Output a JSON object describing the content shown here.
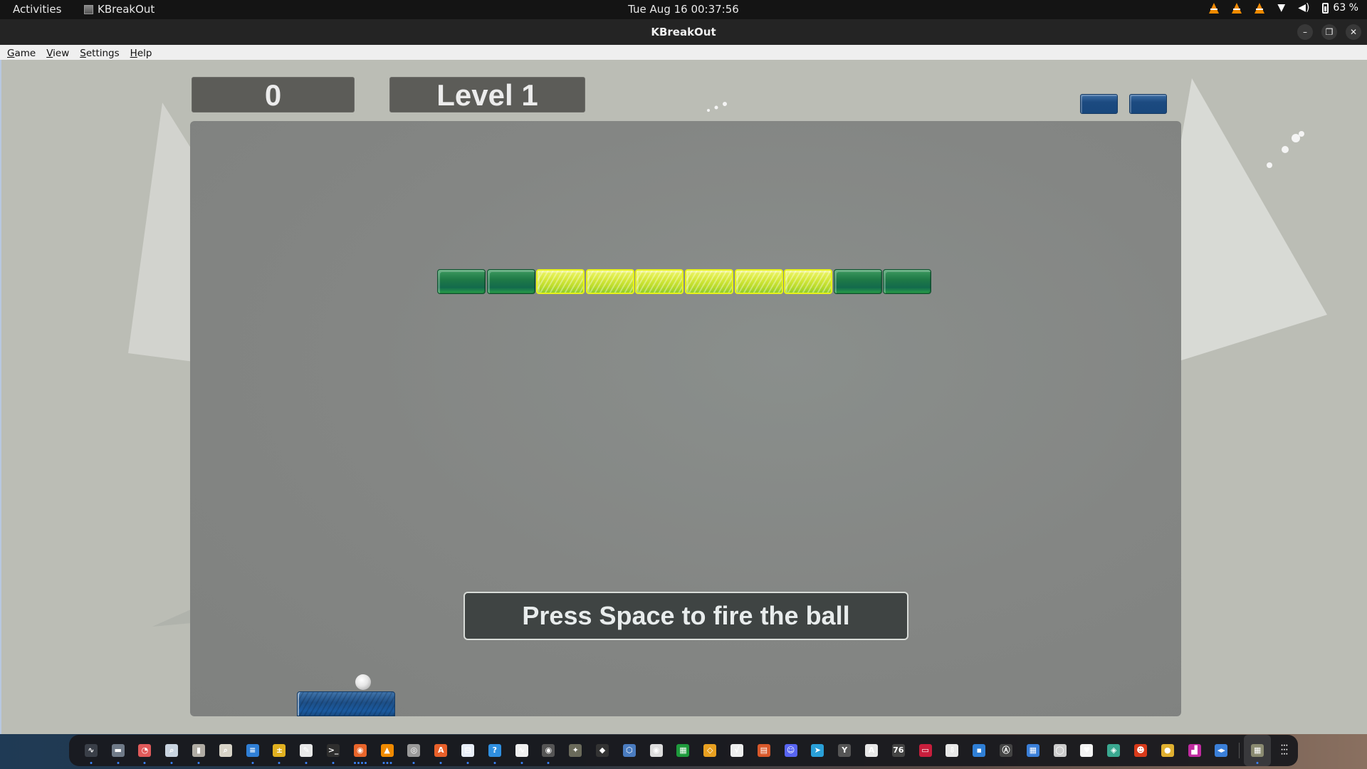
{
  "topbar": {
    "activities": "Activities",
    "app_name": "KBreakOut",
    "clock": "Tue Aug 16  00:37:56",
    "tray": {
      "vlc_icons": 3,
      "wifi_icon": "wifi-icon",
      "volume_icon": "volume-icon",
      "battery_icon": "battery-icon",
      "battery_percent": "63 %"
    }
  },
  "window": {
    "title": "KBreakOut",
    "controls": {
      "minimize": "–",
      "restore": "❐",
      "close": "✕"
    }
  },
  "menu": [
    {
      "label": "Game",
      "mnemonic": "G",
      "rest": "ame"
    },
    {
      "label": "View",
      "mnemonic": "V",
      "rest": "iew"
    },
    {
      "label": "Settings",
      "mnemonic": "S",
      "rest": "ettings"
    },
    {
      "label": "Help",
      "mnemonic": "H",
      "rest": "elp"
    }
  ],
  "game": {
    "score": "0",
    "level": "Level 1",
    "lives_remaining": 2,
    "message": "Press Space to fire the ball",
    "bricks": [
      "green",
      "green",
      "yellow",
      "yellow",
      "yellow",
      "yellow",
      "yellow",
      "yellow",
      "green",
      "green"
    ],
    "colors": {
      "background": "#bbbdb5",
      "field": "#848684",
      "hud_box": "#5c5c58",
      "brick_green": "#1f7a46",
      "brick_yellow": "#d5e83a",
      "paddle": "#1d4f88"
    }
  },
  "dock": {
    "items": [
      {
        "name": "system-monitor",
        "glyph": "∿",
        "color": "#3a3f48",
        "running": 1
      },
      {
        "name": "files",
        "glyph": "▬",
        "color": "#6f7a88",
        "running": 1
      },
      {
        "name": "disk-usage-analyzer",
        "glyph": "◔",
        "color": "#e05a5a",
        "running": 1
      },
      {
        "name": "document-scanner",
        "glyph": "⌕",
        "color": "#c9d4e0",
        "running": 1
      },
      {
        "name": "archive-manager",
        "glyph": "▮",
        "color": "#b0aca4",
        "running": 1
      },
      {
        "name": "image-viewer",
        "glyph": "⌕",
        "color": "#d8d4c8",
        "running": 0
      },
      {
        "name": "text-document",
        "glyph": "≡",
        "color": "#2f7fd6",
        "running": 1
      },
      {
        "name": "calculator",
        "glyph": "±",
        "color": "#e0b020",
        "running": 1
      },
      {
        "name": "text-editor",
        "glyph": "✎",
        "color": "#e8e8e8",
        "running": 1
      },
      {
        "name": "terminal",
        "glyph": ">_",
        "color": "#2e2e2e",
        "running": 1
      },
      {
        "name": "firefox",
        "glyph": "◉",
        "color": "#e8652a",
        "running": 4
      },
      {
        "name": "vlc",
        "glyph": "▲",
        "color": "#f08a00",
        "running": 3
      },
      {
        "name": "settings-disc",
        "glyph": "◎",
        "color": "#9a9a9a",
        "running": 1
      },
      {
        "name": "software-center",
        "glyph": "A",
        "color": "#e8602a",
        "running": 1
      },
      {
        "name": "tweaks",
        "glyph": "⊟",
        "color": "#e8eef8",
        "running": 1
      },
      {
        "name": "help",
        "glyph": "?",
        "color": "#2f8fe0",
        "running": 1
      },
      {
        "name": "waveform-app",
        "glyph": "∿",
        "color": "#f0f0f0",
        "running": 1
      },
      {
        "name": "speaker-app",
        "glyph": "◉",
        "color": "#555",
        "running": 1
      },
      {
        "name": "gimp",
        "glyph": "✦",
        "color": "#6a6a5a",
        "running": 0
      },
      {
        "name": "inkscape",
        "glyph": "◆",
        "color": "#333",
        "running": 0
      },
      {
        "name": "virtualbox",
        "glyph": "⬡",
        "color": "#4a7cc0",
        "running": 0
      },
      {
        "name": "screenshot",
        "glyph": "◉",
        "color": "#ddd",
        "running": 0
      },
      {
        "name": "libreoffice-calc",
        "glyph": "▦",
        "color": "#1e9a3c",
        "running": 0
      },
      {
        "name": "libreoffice-draw",
        "glyph": "◇",
        "color": "#e8a020",
        "running": 0
      },
      {
        "name": "libreoffice-math",
        "glyph": "√",
        "color": "#eee",
        "running": 0
      },
      {
        "name": "libreoffice-impress",
        "glyph": "▤",
        "color": "#d8582a",
        "running": 0
      },
      {
        "name": "discord",
        "glyph": "☺",
        "color": "#5865f2",
        "running": 0
      },
      {
        "name": "telegram",
        "glyph": "➤",
        "color": "#2aa0d8",
        "running": 0
      },
      {
        "name": "yubikey",
        "glyph": "Y",
        "color": "#555",
        "running": 0
      },
      {
        "name": "font-viewer",
        "glyph": "A",
        "color": "#e8e8e8",
        "running": 0
      },
      {
        "name": "clock-76",
        "glyph": "76",
        "color": "#444",
        "running": 0
      },
      {
        "name": "red-app",
        "glyph": "▭",
        "color": "#c81e3c",
        "running": 0
      },
      {
        "name": "installer",
        "glyph": "⇩",
        "color": "#e8e8e8",
        "running": 0
      },
      {
        "name": "window-app",
        "glyph": "▪",
        "color": "#2f7fd6",
        "running": 0
      },
      {
        "name": "accessibility",
        "glyph": "Ⓐ",
        "color": "#444",
        "running": 0
      },
      {
        "name": "sudoku",
        "glyph": "▦",
        "color": "#3a7fd8",
        "running": 0
      },
      {
        "name": "disk-app",
        "glyph": "◯",
        "color": "#ccc",
        "running": 0
      },
      {
        "name": "solitaire",
        "glyph": "♥",
        "color": "#f4f4f4",
        "running": 0
      },
      {
        "name": "mahjongg",
        "glyph": "◈",
        "color": "#3aa890",
        "running": 0
      },
      {
        "name": "mario-game",
        "glyph": "☻",
        "color": "#d83a1a",
        "running": 0
      },
      {
        "name": "chicken-game",
        "glyph": "●",
        "color": "#e0b030",
        "running": 0
      },
      {
        "name": "tetris-game",
        "glyph": "▟",
        "color": "#c02aa0",
        "running": 0
      },
      {
        "name": "code-app",
        "glyph": "◂▸",
        "color": "#3a7fd8",
        "running": 0
      }
    ],
    "active_app": {
      "name": "kbreakout",
      "glyph": "▦",
      "color": "#8a8a70",
      "running": 1
    },
    "show_apps_glyph": "⋮⋮⋮"
  }
}
